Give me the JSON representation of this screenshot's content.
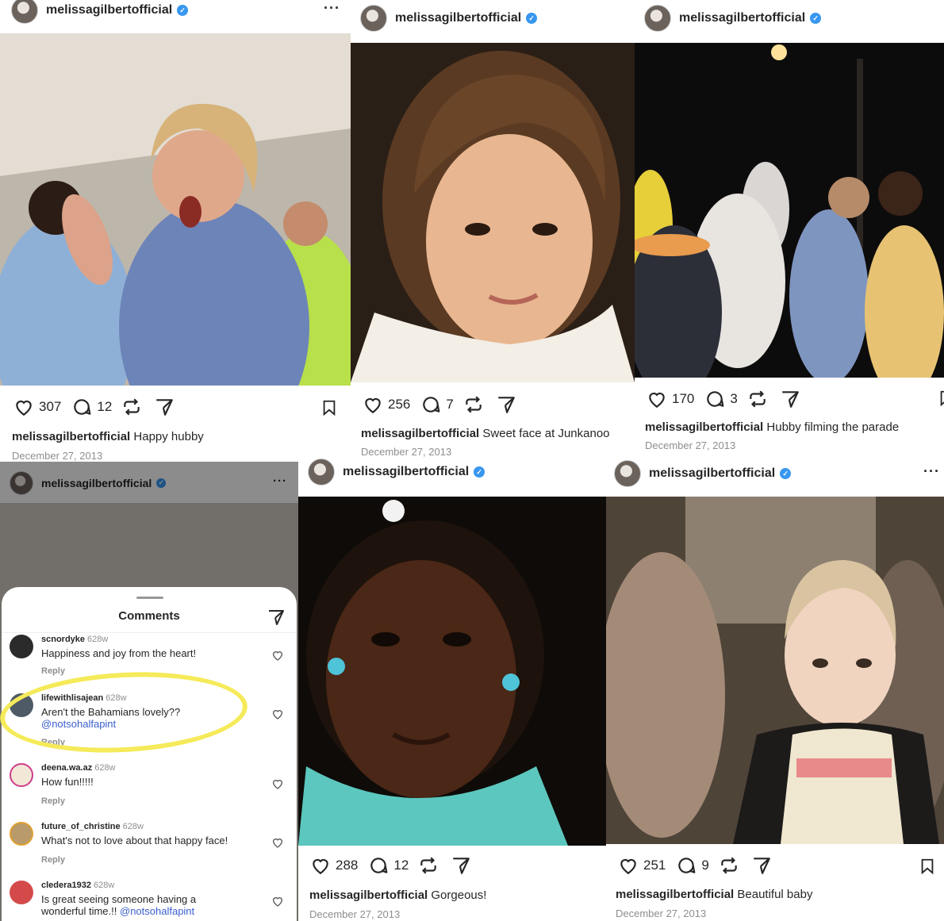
{
  "posts": [
    {
      "username": "melissagilbertofficial",
      "likes": "307",
      "comments": "12",
      "caption": "Happy hubby",
      "date": "December 27, 2013"
    },
    {
      "username": "melissagilbertofficial",
      "likes": "256",
      "comments": "7",
      "caption": "Sweet face at Junkanoo",
      "date": "December 27, 2013"
    },
    {
      "username": "melissagilbertofficial",
      "likes": "170",
      "comments": "3",
      "caption": "Hubby filming the parade",
      "date": "December 27, 2013"
    },
    {
      "username": "melissagilbertofficial",
      "likes": "288",
      "comments": "12",
      "caption": "Gorgeous!",
      "date": "December 27, 2013"
    },
    {
      "username": "melissagilbertofficial",
      "likes": "251",
      "comments": "9",
      "caption": "Beautiful baby",
      "date": "December 27, 2013"
    }
  ],
  "comments_panel": {
    "header_username": "melissagilbertofficial",
    "title": "Comments",
    "items": [
      {
        "user": "scnordyke",
        "age": "628w",
        "text": "Happiness and joy from the heart!",
        "mention": "",
        "reply": "Reply"
      },
      {
        "user": "lifewithlisajean",
        "age": "628w",
        "text": "Aren't the Bahamians lovely??",
        "mention": "@notsohalfapint",
        "reply": "Reply"
      },
      {
        "user": "deena.wa.az",
        "age": "628w",
        "text": "How fun!!!!!",
        "mention": "",
        "reply": "Reply"
      },
      {
        "user": "future_of_christine",
        "age": "628w",
        "text": "What's not to love about that happy face!",
        "mention": "",
        "reply": "Reply"
      },
      {
        "user": "cledera1932",
        "age": "628w",
        "text": "Is great seeing someone having a wonderful time.!!",
        "mention": "@notsohalfapint",
        "reply": ""
      }
    ]
  },
  "icons": [
    "heart-icon",
    "comment-icon",
    "repost-icon",
    "share-icon",
    "bookmark-icon",
    "verified-icon",
    "more-icon"
  ],
  "colors": {
    "verified": "#3897f0",
    "highlight": "#f5ea59",
    "mention": "#3a5fcd",
    "muted": "#8e8e8e"
  }
}
